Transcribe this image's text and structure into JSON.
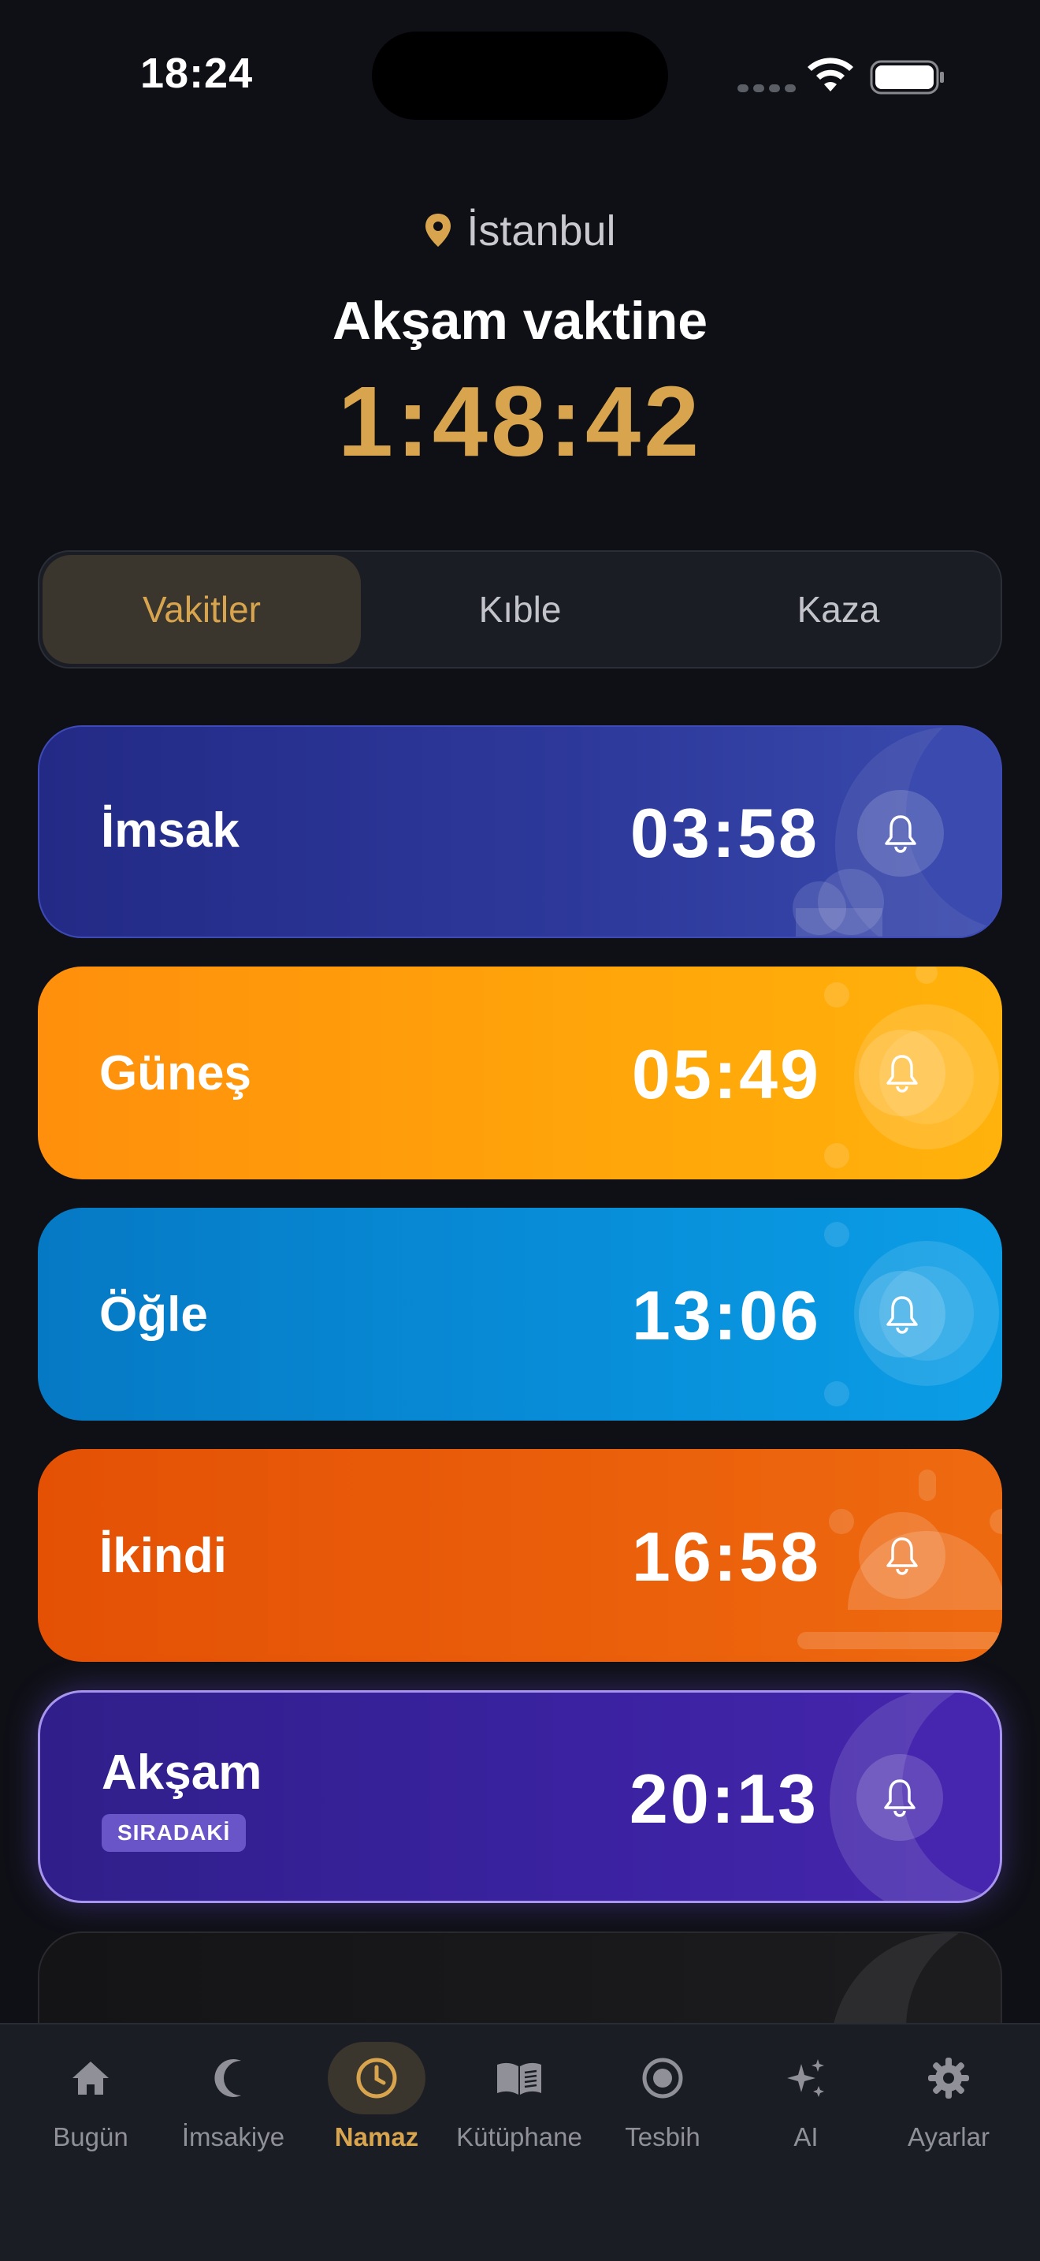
{
  "status_bar": {
    "time": "18:24"
  },
  "header": {
    "location": "İstanbul",
    "countdown_label": "Akşam vaktine",
    "countdown": "1:48:42"
  },
  "segments": [
    {
      "label": "Vakitler",
      "active": true
    },
    {
      "label": "Kıble",
      "active": false
    },
    {
      "label": "Kaza",
      "active": false
    }
  ],
  "prayers": [
    {
      "name": "İmsak",
      "time": "03:58"
    },
    {
      "name": "Güneş",
      "time": "05:49"
    },
    {
      "name": "Öğle",
      "time": "13:06"
    },
    {
      "name": "İkindi",
      "time": "16:58"
    },
    {
      "name": "Akşam",
      "time": "20:13",
      "badge": "SIRADAKİ"
    }
  ],
  "tabs": [
    {
      "label": "Bugün",
      "icon": "home-icon"
    },
    {
      "label": "İmsakiye",
      "icon": "crescent-icon"
    },
    {
      "label": "Namaz",
      "icon": "clock-icon",
      "active": true
    },
    {
      "label": "Kütüphane",
      "icon": "book-icon"
    },
    {
      "label": "Tesbih",
      "icon": "tesbih-icon"
    },
    {
      "label": "AI",
      "icon": "sparkles-icon"
    },
    {
      "label": "Ayarlar",
      "icon": "gear-icon"
    }
  ],
  "colors": {
    "background": "#0f1016",
    "accent": "#d8a54e",
    "imsak": "#2e3a9c",
    "gunes": "#ffa40a",
    "ogle": "#088dd8",
    "ikindi": "#ea5e0a",
    "aksam": "#3a22a0"
  }
}
